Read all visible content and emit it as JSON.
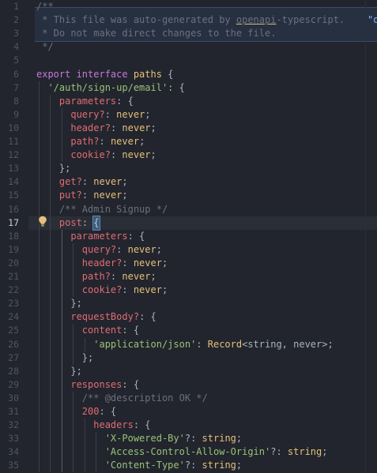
{
  "gutter": {
    "line_numbers": [
      "1",
      "2",
      "3",
      "4",
      "5",
      "6",
      "7",
      "8",
      "9",
      "10",
      "11",
      "12",
      "13",
      "14",
      "15",
      "16",
      "17",
      "18",
      "19",
      "20",
      "21",
      "22",
      "23",
      "24",
      "25",
      "26",
      "27",
      "28",
      "29",
      "30",
      "31",
      "32",
      "33",
      "34",
      "35"
    ],
    "active_line": "17"
  },
  "code": {
    "l1": {
      "comment": "/**"
    },
    "l2": {
      "comment_a": " * This file was auto-generated by ",
      "link": "openapi",
      "comment_b": "-typescript.",
      "trail": "    \"oper"
    },
    "l3": {
      "comment": " * Do not make direct changes to the file."
    },
    "l4": {
      "comment": " */"
    },
    "l5": {},
    "l6": {
      "kw": "export interface",
      "name": " paths ",
      "punct": "{"
    },
    "l7": {
      "indent": "  ",
      "str": "'/auth/sign-up/email'",
      "punct": ": {"
    },
    "l8": {
      "indent": "    ",
      "prop": "parameters",
      "punct": ": {"
    },
    "l9": {
      "indent": "      ",
      "prop": "query?",
      "punct": ": ",
      "type": "never",
      "end": ";"
    },
    "l10": {
      "indent": "      ",
      "prop": "header?",
      "punct": ": ",
      "type": "never",
      "end": ";"
    },
    "l11": {
      "indent": "      ",
      "prop": "path?",
      "punct": ": ",
      "type": "never",
      "end": ";"
    },
    "l12": {
      "indent": "      ",
      "prop": "cookie?",
      "punct": ": ",
      "type": "never",
      "end": ";"
    },
    "l13": {
      "indent": "    ",
      "punct": "};"
    },
    "l14": {
      "indent": "    ",
      "prop": "get?",
      "punct": ": ",
      "type": "never",
      "end": ";"
    },
    "l15": {
      "indent": "    ",
      "prop": "put?",
      "punct": ": ",
      "type": "never",
      "end": ";"
    },
    "l16": {
      "indent": "    ",
      "comment": "/** Admin Signup */"
    },
    "l17": {
      "indent": "    ",
      "prop": "post",
      "punct": ": ",
      "bracket": "{"
    },
    "l18": {
      "indent": "      ",
      "prop": "parameters",
      "punct": ": {"
    },
    "l19": {
      "indent": "        ",
      "prop": "query?",
      "punct": ": ",
      "type": "never",
      "end": ";"
    },
    "l20": {
      "indent": "        ",
      "prop": "header?",
      "punct": ": ",
      "type": "never",
      "end": ";"
    },
    "l21": {
      "indent": "        ",
      "prop": "path?",
      "punct": ": ",
      "type": "never",
      "end": ";"
    },
    "l22": {
      "indent": "        ",
      "prop": "cookie?",
      "punct": ": ",
      "type": "never",
      "end": ";"
    },
    "l23": {
      "indent": "      ",
      "punct": "};"
    },
    "l24": {
      "indent": "      ",
      "prop": "requestBody?",
      "punct": ": {"
    },
    "l25": {
      "indent": "        ",
      "prop": "content",
      "punct": ": {"
    },
    "l26": {
      "indent": "          ",
      "str": "'application/json'",
      "punct": ": ",
      "type": "Record",
      "gen": "<string, never>",
      "end": ";"
    },
    "l27": {
      "indent": "        ",
      "punct": "};"
    },
    "l28": {
      "indent": "      ",
      "punct": "};"
    },
    "l29": {
      "indent": "      ",
      "prop": "responses",
      "punct": ": {"
    },
    "l30": {
      "indent": "        ",
      "comment": "/** @description OK */"
    },
    "l31": {
      "indent": "        ",
      "prop": "200",
      "punct": ": {"
    },
    "l32": {
      "indent": "          ",
      "prop": "headers",
      "punct": ": {"
    },
    "l33": {
      "indent": "            ",
      "str": "'X-Powered-By'",
      "punct": "?: ",
      "type": "string",
      "end": ";"
    },
    "l34": {
      "indent": "            ",
      "str": "'Access-Control-Allow-Origin'",
      "punct": "?: ",
      "type": "string",
      "end": ";"
    },
    "l35": {
      "indent": "            ",
      "str": "'Content-Type'",
      "punct": "?: ",
      "type": "string",
      "end": ";"
    }
  },
  "colors": {
    "background": "#22252d",
    "comment": "#6a717e",
    "keyword": "#c678dd",
    "property": "#e06c75",
    "string": "#98c379",
    "type": "#e5c07b"
  },
  "icons": {
    "lightbulb": "lightbulb-icon"
  }
}
